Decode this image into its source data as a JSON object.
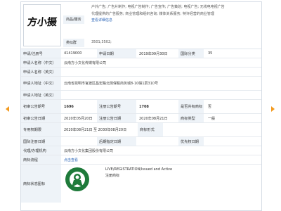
{
  "logo_text": "方小摄",
  "top": {
    "services_label": "商品/服务",
    "services_text_1": "户外广告; 广告片制作; 电视广告制作; 广告宣传; 广告策划; 电视广告; 无线电电视广告",
    "services_text_2": "代理提供的广告服务; 商业管理和组织咨询; 媒体关系服务; 特许经营的商业管理",
    "more_link": "查看详细信息",
    "group_label": "类似群",
    "group_value": "3501;3502;"
  },
  "rows": {
    "reg_no_label": "申请/注册号",
    "reg_no": "41419000",
    "apply_date_label": "申请日期",
    "apply_date": "2019年09月30日",
    "class_label": "国际分类",
    "class": "35",
    "applicant_cn_label": "申请人名称（中文）",
    "applicant_cn": "云南方小文化传媒有限公司",
    "applicant_en_label": "申请人名称（英文）",
    "applicant_en": "",
    "addr_cn_label": "申请人地址（中文）",
    "addr_cn": "云南省昆明市官渡区昌宏路北侧保税商务城8-10幢1层310号",
    "addr_en_label": "申请人地址（英文）",
    "addr_en": "",
    "prelim_no_label": "初审公告期号",
    "prelim_no": "1696",
    "reg_pub_no_label": "注册公告期号",
    "reg_pub_no": "1708",
    "shared_label": "是否共有商标",
    "shared": "否",
    "prelim_date_label": "初审公告日期",
    "prelim_date": "2020年05月20日",
    "reg_date_label": "注册公告日期",
    "reg_date": "2020年08月21日",
    "type_label": "商标类型",
    "type": "一般",
    "valid_label": "专用权期限",
    "valid": "2020年08月21日 至 2030年08月20日",
    "form_label": "商标形式",
    "form": "",
    "intl_date_label": "国际注册日期",
    "intl_date": "",
    "later_date_label": "后期指定日期",
    "later_date": "",
    "priority_label": "优先权日期",
    "priority": "",
    "agent_label": "代理/办理机构",
    "agent": "云南方小文化集团股份有限公司",
    "flow_label": "商标流程",
    "flow_link": "点击查看",
    "status_icon_label": "商标状态图标",
    "status_en": "LIVE/REGISTRATION/Issued and Active",
    "status_cn": "注册商标"
  },
  "colors": {
    "label_bg": "#eef3f8",
    "link": "#2c66b8",
    "arrow": "#f39a1e",
    "seal": "#1e7a3a"
  }
}
